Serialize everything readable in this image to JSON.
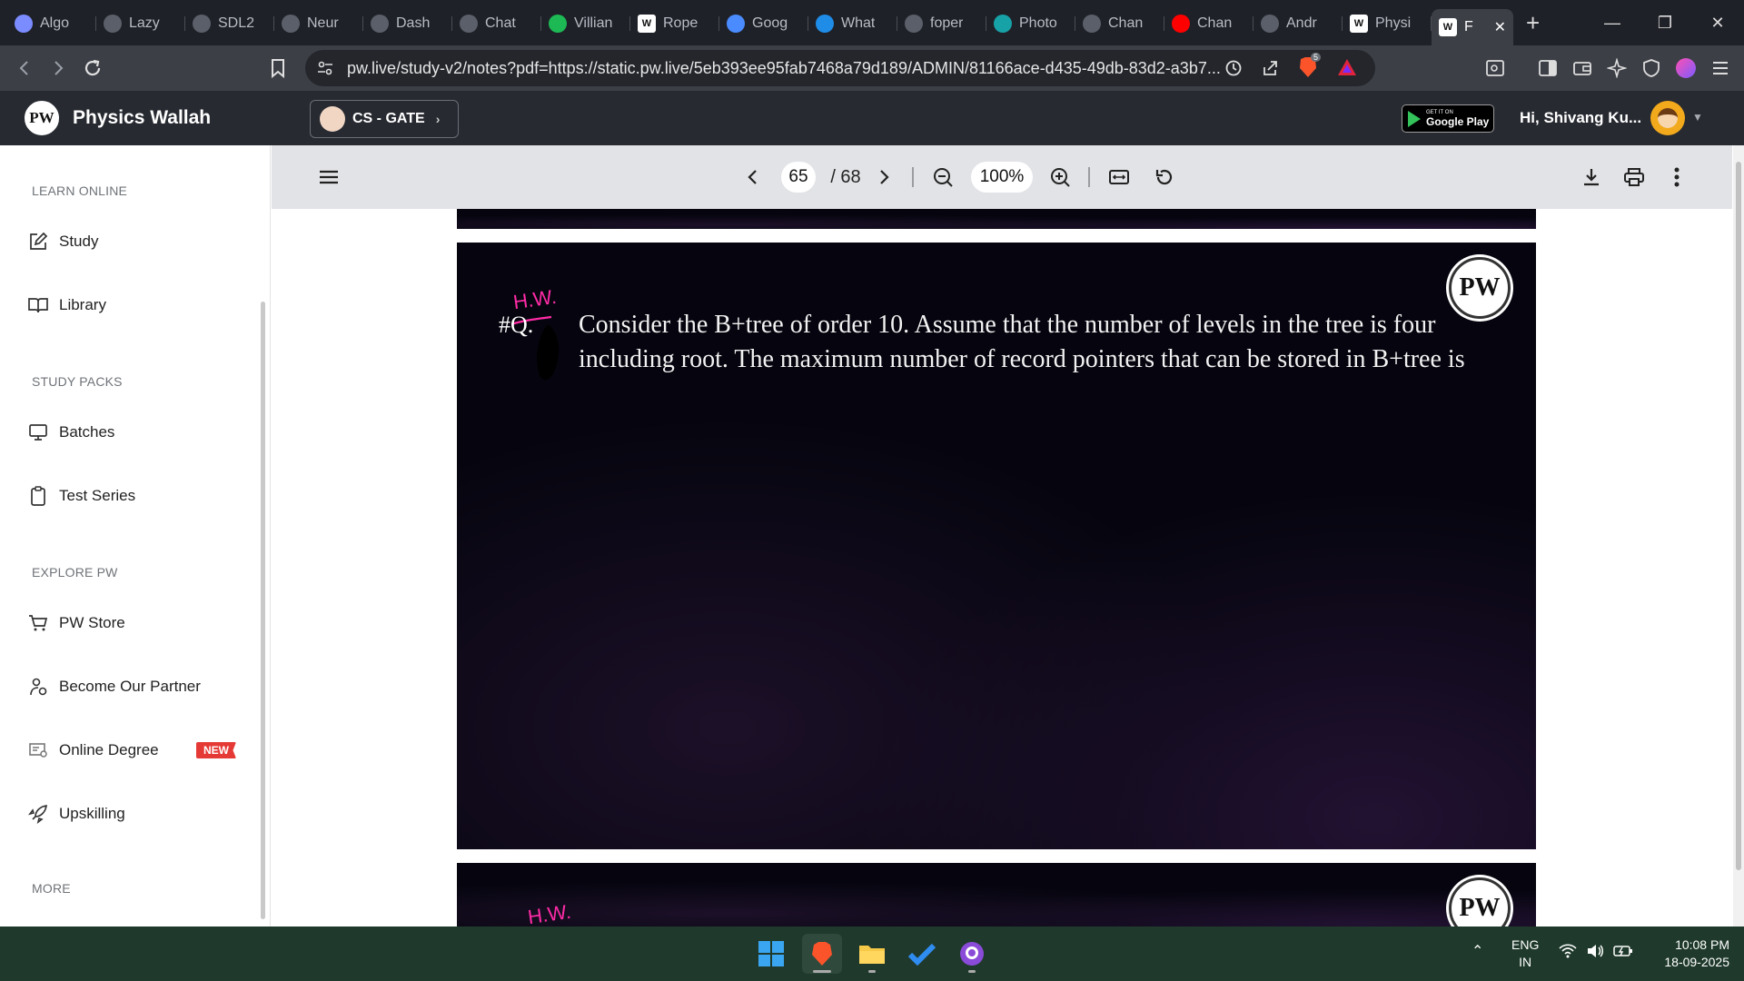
{
  "browser": {
    "tabs": [
      {
        "label": "Algo",
        "icon": "globe-icon",
        "color": "#7a8cff"
      },
      {
        "label": "Lazy",
        "icon": "globe-icon",
        "color": "#5a5f69"
      },
      {
        "label": "SDL2",
        "icon": "globe-icon",
        "color": "#5a5f69"
      },
      {
        "label": "Neur",
        "icon": "globe-icon",
        "color": "#5a5f69"
      },
      {
        "label": "Dash",
        "icon": "globe-icon",
        "color": "#5a5f69"
      },
      {
        "label": "Chat",
        "icon": "chatgpt-icon",
        "color": "#5a5f69"
      },
      {
        "label": "Villian",
        "icon": "spotify-icon",
        "color": "#1db954"
      },
      {
        "label": "Rope",
        "icon": "w-icon",
        "color": "#ffffff"
      },
      {
        "label": "Goog",
        "icon": "gemini-icon",
        "color": "#4a8cff"
      },
      {
        "label": "What",
        "icon": "orm-icon",
        "color": "#1f8de8"
      },
      {
        "label": "foper",
        "icon": "globe-icon",
        "color": "#5a5f69"
      },
      {
        "label": "Photo",
        "icon": "photopea-icon",
        "color": "#17a2a8"
      },
      {
        "label": "Chan",
        "icon": "globe-icon",
        "color": "#5a5f69"
      },
      {
        "label": "Chan",
        "icon": "youtube-icon",
        "color": "#ff0000"
      },
      {
        "label": "Andr",
        "icon": "chatgpt-icon",
        "color": "#5a5f69"
      },
      {
        "label": "Physi",
        "icon": "pw-icon",
        "color": "#ffffff"
      }
    ],
    "active_tab": {
      "label": "F",
      "icon": "pw-icon",
      "close": "✕"
    },
    "new_tab": "+",
    "url": "pw.live/study-v2/notes?pdf=https://static.pw.live/5eb393ee95fab7468a79d189/ADMIN/81166ace-d435-49db-83d2-a3b7...",
    "brave_badge": "5"
  },
  "site": {
    "brand": "Physics Wallah",
    "logo_text": "PW",
    "course": "CS - GATE",
    "google_play_small": "GET IT ON",
    "google_play_big": "Google Play",
    "greeting": "Hi, Shivang Ku..."
  },
  "sidebar": {
    "sections": [
      {
        "title": "LEARN ONLINE",
        "items": [
          {
            "label": "Study",
            "icon": "pencil-square-icon"
          },
          {
            "label": "Library",
            "icon": "book-open-icon"
          }
        ]
      },
      {
        "title": "STUDY PACKS",
        "items": [
          {
            "label": "Batches",
            "icon": "monitor-icon"
          },
          {
            "label": "Test Series",
            "icon": "clipboard-icon"
          }
        ]
      },
      {
        "title": "EXPLORE PW",
        "items": [
          {
            "label": "PW Store",
            "icon": "cart-icon"
          },
          {
            "label": "Become Our Partner",
            "icon": "partner-icon"
          },
          {
            "label": "Online Degree",
            "icon": "degree-icon",
            "badge": "NEW"
          },
          {
            "label": "Upskilling",
            "icon": "rocket-icon"
          }
        ]
      },
      {
        "title": "MORE",
        "items": []
      }
    ]
  },
  "pdf": {
    "current_page": "65",
    "total_pages": "/ 68",
    "zoom": "100%",
    "question_label": "#Q.",
    "hw_mark": "H.W.",
    "question_text": "Consider the B+tree of order 10. Assume that the number of levels in the tree is four including root. The maximum number of record pointers that can be stored in B+tree is",
    "watermark": "PW"
  },
  "taskbar": {
    "language": "ENG",
    "region": "IN",
    "time": "10:08 PM",
    "date": "18-09-2025"
  },
  "colors": {
    "brand_dark": "#272a31",
    "pdf_page": "#06050f",
    "hw_pink": "#ff2ba6",
    "new_badge": "#e53935",
    "taskbar": "#1f3a2c"
  }
}
